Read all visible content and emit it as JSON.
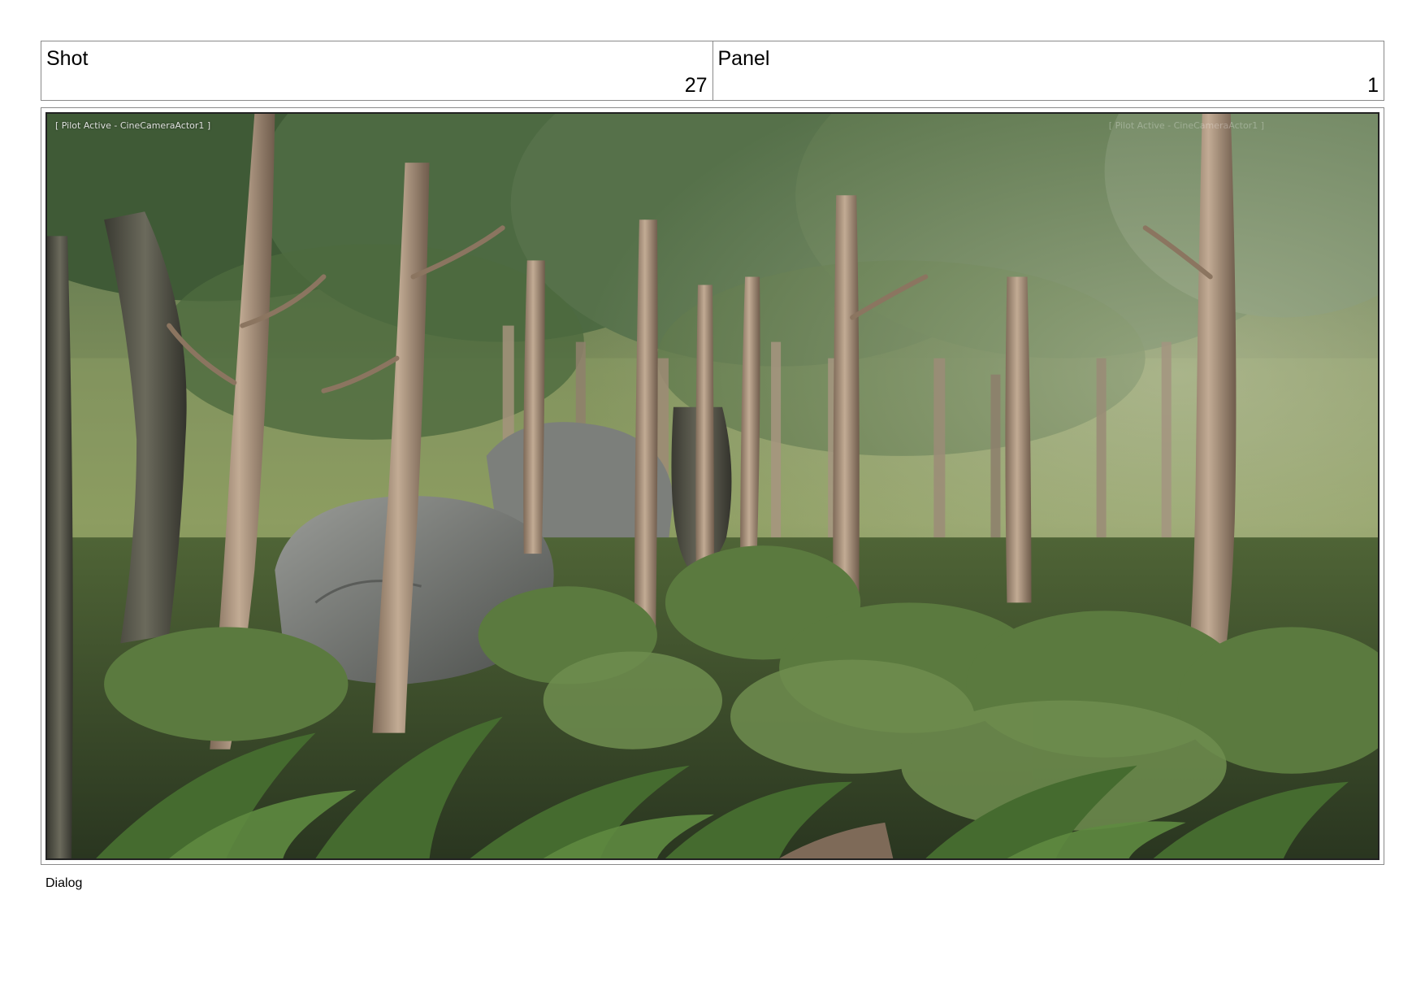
{
  "shot": {
    "label": "Shot",
    "value": "27"
  },
  "panel": {
    "label": "Panel",
    "value": "1"
  },
  "image": {
    "overlay_left": "[ Pilot Active - CineCameraActor1 ]",
    "overlay_right": "[ Pilot Active - CineCameraActor1 ]"
  },
  "dialog": {
    "label": "Dialog"
  }
}
